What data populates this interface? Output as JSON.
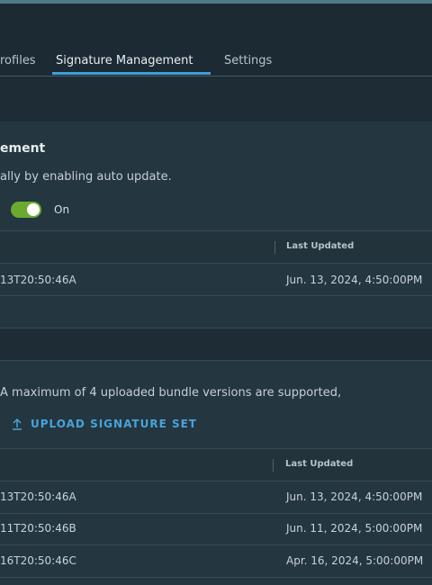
{
  "tabs": [
    {
      "label": "rofiles"
    },
    {
      "label": "Signature Management"
    },
    {
      "label": "Settings"
    }
  ],
  "auto_update": {
    "title": "ement",
    "description": "ally by enabling auto update.",
    "toggle_state": "On"
  },
  "table1": {
    "header_last_updated": "Last Updated",
    "rows": [
      {
        "version": "13T20:50:46A",
        "updated": "Jun. 13, 2024, 4:50:00PM"
      }
    ]
  },
  "uploaded": {
    "note": "A maximum of 4 uploaded bundle versions are supported,",
    "upload_button": "UPLOAD SIGNATURE SET"
  },
  "table2": {
    "header_last_updated": "Last Updated",
    "rows": [
      {
        "version": "13T20:50:46A",
        "updated": "Jun. 13, 2024, 4:50:00PM"
      },
      {
        "version": "11T20:50:46B",
        "updated": "Jun. 11, 2024, 5:00:00PM"
      },
      {
        "version": "16T20:50:46C",
        "updated": "Apr. 16, 2024, 5:00:00PM"
      }
    ]
  },
  "colors": {
    "accent": "#3f9dd6",
    "toggle_on": "#6aab2f",
    "link": "#49a3d9"
  }
}
